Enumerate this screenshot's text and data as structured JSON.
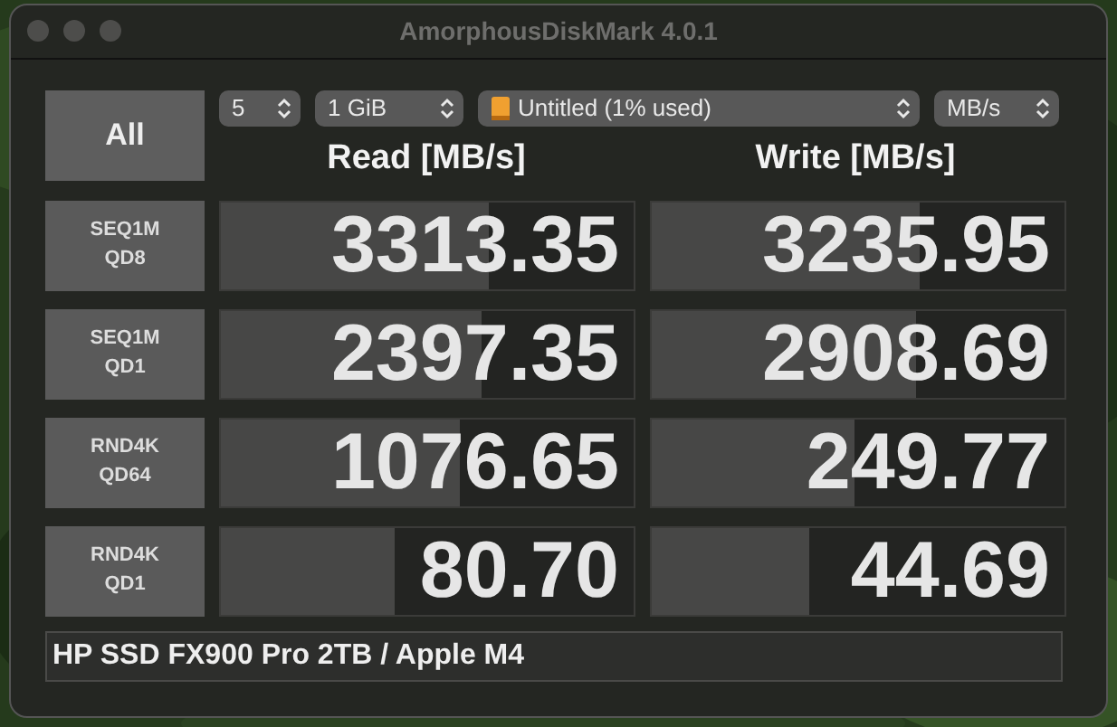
{
  "window": {
    "title": "AmorphousDiskMark 4.0.1"
  },
  "all_button": "All",
  "selects": [
    {
      "kind": "plain",
      "value": "5"
    },
    {
      "kind": "plain",
      "value": "1 GiB"
    },
    {
      "kind": "drive",
      "value": "Untitled (1% used)"
    },
    {
      "kind": "plain",
      "value": "MB/s"
    }
  ],
  "headers": [
    "Read [MB/s]",
    "Write [MB/s]"
  ],
  "tests": [
    {
      "label": [
        "SEQ1M",
        "QD8"
      ],
      "read": {
        "value": "3313.35",
        "level": 0.65
      },
      "write": {
        "value": "3235.95",
        "level": 0.65
      }
    },
    {
      "label": [
        "SEQ1M",
        "QD1"
      ],
      "read": {
        "value": "2397.35",
        "level": 0.63
      },
      "write": {
        "value": "2908.69",
        "level": 0.64
      }
    },
    {
      "label": [
        "RND4K",
        "QD64"
      ],
      "read": {
        "value": "1076.65",
        "level": 0.58
      },
      "write": {
        "value": "249.77",
        "level": 0.49
      }
    },
    {
      "label": [
        "RND4K",
        "QD1"
      ],
      "read": {
        "value": "80.70",
        "level": 0.42
      },
      "write": {
        "value": "44.69",
        "level": 0.38
      }
    }
  ],
  "footer": "HP SSD FX900 Pro 2TB / Apple M4"
}
